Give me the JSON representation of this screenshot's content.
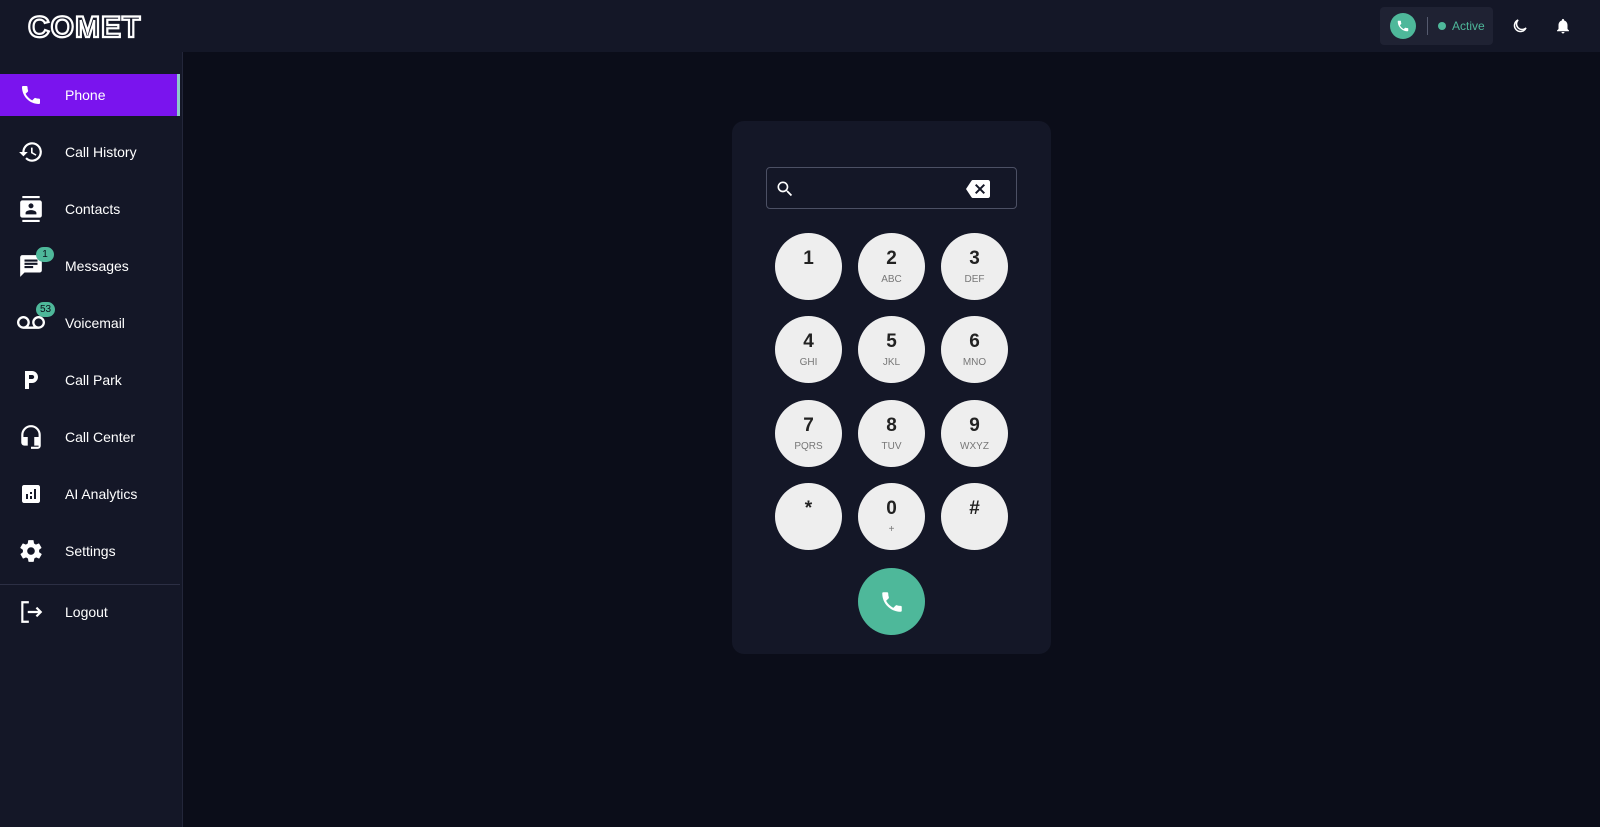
{
  "brand": {
    "logo_text": "COMET"
  },
  "header": {
    "status_text": "Active",
    "status_color": "#4eb89a",
    "icons": [
      "phone-icon",
      "moon-icon",
      "bell-icon"
    ]
  },
  "sidebar": {
    "accent_color": "#7a14ee",
    "items": [
      {
        "label": "Phone",
        "icon": "phone-icon",
        "active": true
      },
      {
        "label": "Call History",
        "icon": "history-icon"
      },
      {
        "label": "Contacts",
        "icon": "contacts-icon"
      },
      {
        "label": "Messages",
        "icon": "message-icon",
        "badge": "1"
      },
      {
        "label": "Voicemail",
        "icon": "voicemail-icon",
        "badge": "53"
      },
      {
        "label": "Call Park",
        "icon": "parking-icon"
      },
      {
        "label": "Call Center",
        "icon": "headset-icon"
      },
      {
        "label": "AI Analytics",
        "icon": "analytics-icon"
      },
      {
        "label": "Settings",
        "icon": "gear-icon"
      }
    ],
    "logout": {
      "label": "Logout",
      "icon": "logout-icon"
    }
  },
  "dialer": {
    "input_value": "",
    "keys": [
      {
        "digit": "1",
        "letters": ""
      },
      {
        "digit": "2",
        "letters": "ABC"
      },
      {
        "digit": "3",
        "letters": "DEF"
      },
      {
        "digit": "4",
        "letters": "GHI"
      },
      {
        "digit": "5",
        "letters": "JKL"
      },
      {
        "digit": "6",
        "letters": "MNO"
      },
      {
        "digit": "7",
        "letters": "PQRS"
      },
      {
        "digit": "8",
        "letters": "TUV"
      },
      {
        "digit": "9",
        "letters": "WXYZ"
      },
      {
        "digit": "*",
        "letters": ""
      },
      {
        "digit": "0",
        "letters": "+"
      },
      {
        "digit": "#",
        "letters": ""
      }
    ],
    "call_color": "#4eb89a"
  }
}
